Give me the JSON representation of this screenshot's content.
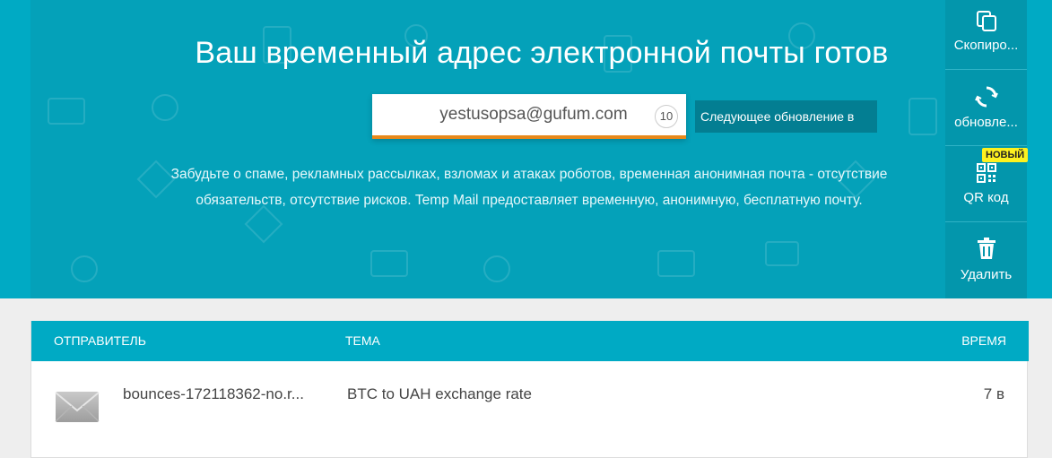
{
  "hero": {
    "title": "Ваш временный адрес электронной почты готов",
    "email": "yestusopsa@gufum.com",
    "counter": "10",
    "next_update": "Следующее обновление в",
    "description": "Забудьте о спаме, рекламных рассылках, взломах и атаках роботов, временная анонимная почта - отсутствие обязательств, отсутствие рисков. Temp Mail предоставляет временную, анонимную, бесплатную почту."
  },
  "sidebar": {
    "copy": {
      "label": "Скопиро...",
      "icon": "copy-icon"
    },
    "refresh": {
      "label": "обновле...",
      "icon": "refresh-icon"
    },
    "qr": {
      "label": "QR код",
      "icon": "qr-code-icon",
      "badge": "НОВЫЙ"
    },
    "delete": {
      "label": "Удалить",
      "icon": "trash-icon"
    }
  },
  "inbox": {
    "columns": {
      "sender": "ОТПРАВИТЕЛЬ",
      "subject": "ТЕМА",
      "time": "ВРЕМЯ"
    },
    "messages": [
      {
        "sender": "bounces-172118362-no.r...",
        "subject": "BTC to UAH exchange rate",
        "time": "7 в",
        "icon": "envelope-icon"
      }
    ]
  },
  "colors": {
    "primary": "#00aac4",
    "hero_inner": "#04a1b9",
    "sidebar": "#0396ac",
    "accent_underline": "#e8891a",
    "badge": "#fdf11f"
  }
}
